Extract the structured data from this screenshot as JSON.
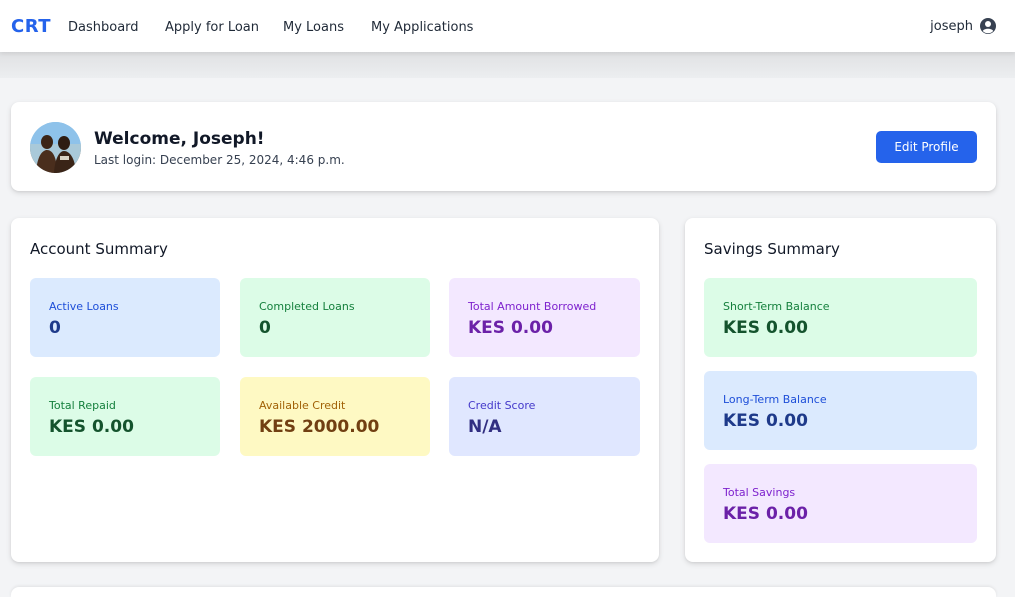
{
  "nav": {
    "brand": "CRT",
    "links": [
      "Dashboard",
      "Apply for Loan",
      "My Loans",
      "My Applications"
    ],
    "username": "joseph",
    "user_icon": "user-circle-icon"
  },
  "welcome": {
    "title": "Welcome, Joseph!",
    "last_login": "Last login: December 25, 2024, 4:46 p.m.",
    "edit_button": "Edit Profile"
  },
  "account_summary": {
    "title": "Account Summary",
    "stats": [
      {
        "label": "Active Loans",
        "value": "0",
        "bg": "#dbeafe",
        "label_color": "#1d4ed8",
        "value_color": "#1e3a8a"
      },
      {
        "label": "Completed Loans",
        "value": "0",
        "bg": "#dcfce7",
        "label_color": "#15803d",
        "value_color": "#14532d"
      },
      {
        "label": "Total Amount Borrowed",
        "value": "KES 0.00",
        "bg": "#f3e8ff",
        "label_color": "#7e22ce",
        "value_color": "#6b21a8"
      },
      {
        "label": "Total Repaid",
        "value": "KES 0.00",
        "bg": "#dcfce7",
        "label_color": "#15803d",
        "value_color": "#14532d"
      },
      {
        "label": "Available Credit",
        "value": "KES 2000.00",
        "bg": "#fef9c3",
        "label_color": "#a16207",
        "value_color": "#713f12"
      },
      {
        "label": "Credit Score",
        "value": "N/A",
        "bg": "#e0e7ff",
        "label_color": "#4338ca",
        "value_color": "#312e81"
      }
    ]
  },
  "savings_summary": {
    "title": "Savings Summary",
    "stats": [
      {
        "label": "Short-Term Balance",
        "value": "KES 0.00",
        "bg": "#dcfce7",
        "label_color": "#15803d",
        "value_color": "#14532d"
      },
      {
        "label": "Long-Term Balance",
        "value": "KES 0.00",
        "bg": "#dbeafe",
        "label_color": "#1d4ed8",
        "value_color": "#1e3a8a"
      },
      {
        "label": "Total Savings",
        "value": "KES 0.00",
        "bg": "#f3e8ff",
        "label_color": "#7e22ce",
        "value_color": "#6b21a8"
      }
    ]
  }
}
